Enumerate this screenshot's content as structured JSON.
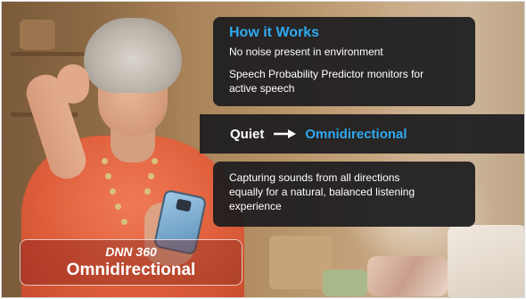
{
  "how_it_works": {
    "title": "How it Works",
    "line1": "No noise present in environment",
    "line2a": "Speech Probability Predictor monitors for",
    "line2b": "active speech"
  },
  "mode": {
    "from": "Quiet",
    "to": "Omnidirectional",
    "arrow_icon": "right-arrow-icon"
  },
  "description": {
    "line1": "Capturing sounds from all directions",
    "line2": "equally for a natural, balanced listening",
    "line3": "experience"
  },
  "badge": {
    "top": "DNN 360",
    "main": "Omnidirectional"
  },
  "colors": {
    "accent": "#2fa9f0",
    "panel": "#1c1c1e",
    "shirt": "#e0603c"
  }
}
